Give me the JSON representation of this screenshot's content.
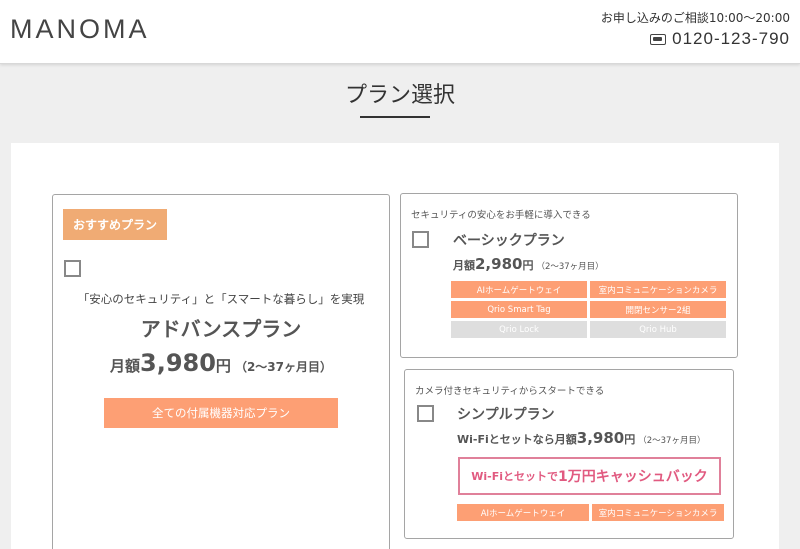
{
  "header": {
    "logo": "MANOMA",
    "hours": "お申し込みのご相談10:00〜20:00",
    "phone": "0120-123-790"
  },
  "page_title": "プラン選択",
  "plans": {
    "advanced": {
      "badge": "おすすめプラン",
      "tagline": "「安心のセキュリティ」と「スマートな暮らし」を実現",
      "name": "アドバンスプラン",
      "price_label": "月額",
      "price_value": "3,980",
      "price_unit": "円",
      "price_period": "（2〜37ヶ月目）",
      "button": "全ての付属機器対応プラン"
    },
    "basic": {
      "subtitle": "セキュリティの安心をお手軽に導入できる",
      "name": "ベーシックプラン",
      "price_label": "月額",
      "price_value": "2,980",
      "price_unit": "円",
      "price_period": "（2〜37ヶ月目）",
      "tags": [
        {
          "label": "AIホームゲートウェイ",
          "active": true
        },
        {
          "label": "室内コミュニケーションカメラ",
          "active": true
        },
        {
          "label": "Qrio Smart Tag",
          "active": true
        },
        {
          "label": "開閉センサー2組",
          "active": true
        },
        {
          "label": "Qrio Lock",
          "active": false
        },
        {
          "label": "Qrio Hub",
          "active": false
        }
      ]
    },
    "simple": {
      "subtitle": "カメラ付きセキュリティからスタートできる",
      "name": "シンプルプラン",
      "price_label": "Wi-Fiとセットなら月額",
      "price_value": "3,980",
      "price_unit": "円",
      "price_period": "（2〜37ヶ月目）",
      "cashback_prefix": "Wi-Fiとセットで",
      "cashback_amount": "1万円キャッシュバック",
      "tags": [
        {
          "label": "AIホームゲートウェイ",
          "active": true
        },
        {
          "label": "室内コミュニケーションカメラ",
          "active": true
        }
      ]
    }
  },
  "colors": {
    "badge": "#f0ab74",
    "accent": "#fd9f74",
    "inactive_tag": "#dedede",
    "cashback": "#e15a80"
  }
}
